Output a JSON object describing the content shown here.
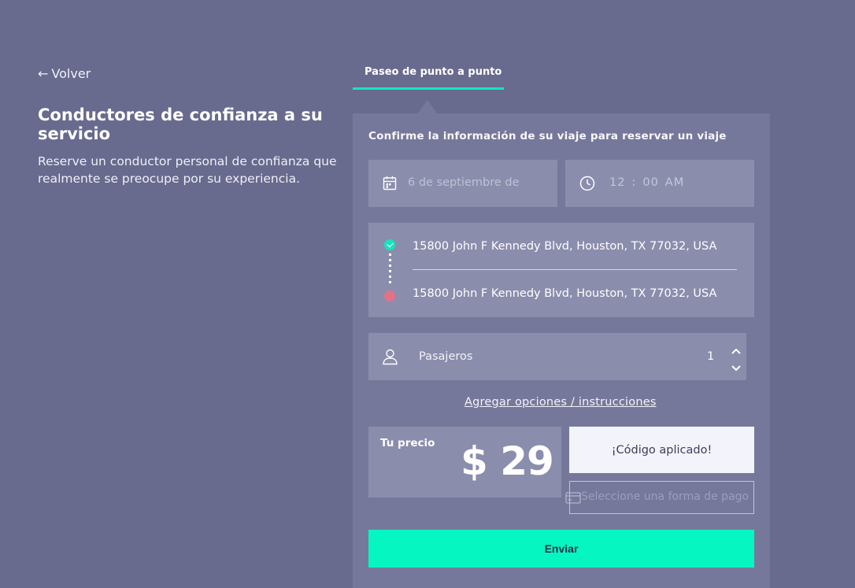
{
  "nav": {
    "back_label": "Volver"
  },
  "hero": {
    "title": "Conductores de confianza a su servicio",
    "description": "Reserve un conductor personal de confianza que realmente se preocupe por su experiencia."
  },
  "tabs": [
    {
      "label": "Paseo de punto a punto",
      "active": true
    }
  ],
  "form": {
    "heading": "Confirme la información de su viaje para reservar un viaje",
    "date": {
      "value": "6 de septiembre de",
      "icon": "calendar-icon"
    },
    "time": {
      "hour": "12",
      "separator": ":",
      "minute": "00",
      "period": "AM",
      "icon": "clock-icon"
    },
    "route": {
      "from": "15800 John F Kennedy Blvd, Houston, TX 77032, USA",
      "to": "15800 John F Kennedy Blvd, Houston, TX 77032, USA"
    },
    "passengers": {
      "label": "Pasajeros",
      "value": "1",
      "icon": "person-icon"
    },
    "options_link": "Agregar opciones / instrucciones",
    "price": {
      "label": "Tu precio",
      "value": "$ 29"
    },
    "code_applied": "¡Código aplicado!",
    "payment": {
      "placeholder": "Seleccione una forma de pago",
      "icon": "credit-card-icon"
    },
    "submit_label": "Enviar"
  },
  "colors": {
    "background": "#686a8e",
    "card": "#76789b",
    "field": "#8b8dad",
    "accent": "#06f6c1",
    "destination": "#e0738a"
  }
}
